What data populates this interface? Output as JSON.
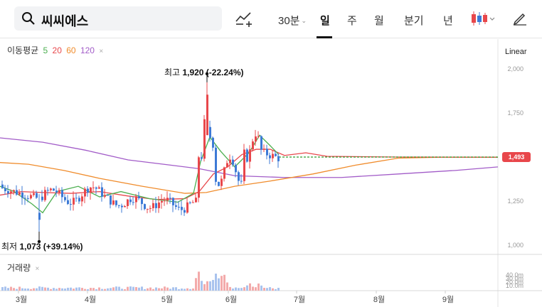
{
  "search": {
    "query": "씨씨에스"
  },
  "toolbar": {
    "interval_30m": "30분",
    "tab_day": "일",
    "tab_week": "주",
    "tab_month": "월",
    "tab_quarter": "분기",
    "tab_year": "년",
    "active_tab": "일"
  },
  "legend": {
    "title": "이동평균",
    "ma5": "5",
    "ma20": "20",
    "ma60": "60",
    "ma120": "120",
    "close": "×"
  },
  "colors": {
    "up": "#e8474b",
    "down": "#3d7ad6",
    "ma5": "#4caf50",
    "ma20": "#e8474b",
    "ma60": "#f08c2c",
    "ma120": "#a25cc8"
  },
  "scale_mode": "Linear",
  "current_price": "1,493",
  "annotations": {
    "high_label": "최고",
    "high_value": "1,920 (-22.24%)",
    "low_label": "최저",
    "low_value": "1,073 (+39.14%)"
  },
  "volume": {
    "title": "거래량",
    "ticks": [
      "40.0m",
      "30.0m",
      "20.0m",
      "10.0m"
    ]
  },
  "chart_data": {
    "type": "candlestick",
    "y_ticks": [
      1000,
      1250,
      1500,
      1750,
      2000
    ],
    "y_tick_labels": [
      "1,000",
      "1,250",
      "1,500",
      "1,750",
      "2,000"
    ],
    "ylim": [
      970,
      2020
    ],
    "x_month_labels": [
      "3월",
      "4월",
      "5월",
      "6월",
      "7월",
      "8월",
      "9월"
    ],
    "high": 1920,
    "low": 1073,
    "last": 1493
  }
}
